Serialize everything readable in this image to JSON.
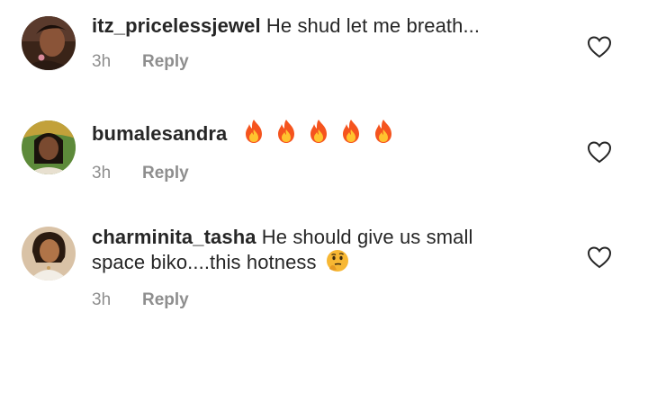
{
  "comments": [
    {
      "username": "itz_pricelessjewel",
      "text": "He shud let me breath...",
      "time": "3h",
      "reply_label": "Reply",
      "emoji": []
    },
    {
      "username": "bumalesandra",
      "text": "",
      "time": "3h",
      "reply_label": "Reply",
      "emoji": [
        "fire-icon",
        "fire-icon",
        "fire-icon",
        "fire-icon",
        "fire-icon"
      ]
    },
    {
      "username": "charminita_tasha",
      "text": "He should give us small space biko....this hotness",
      "time": "3h",
      "reply_label": "Reply",
      "emoji": [
        "thinking-face-icon"
      ]
    }
  ],
  "colors": {
    "text": "#262626",
    "muted": "#8e8e8e",
    "fire_outer": "#f5541e",
    "fire_inner": "#ffc32e",
    "thinking": "#f7b733"
  }
}
